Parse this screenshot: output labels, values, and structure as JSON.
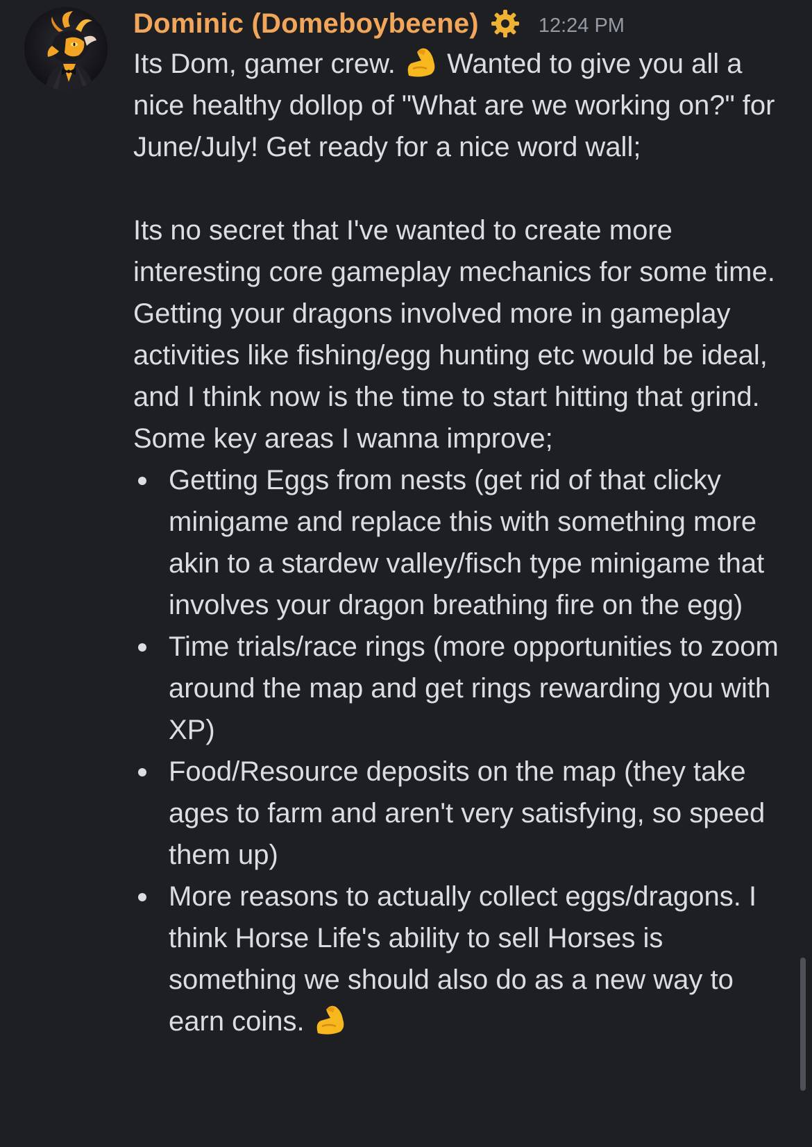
{
  "message": {
    "author": {
      "display_name": "Dominic (Domeboybeene)",
      "avatar_icon": "dragon-avatar-icon",
      "role_icon": "gear-icon",
      "name_color": "#f2a65a"
    },
    "timestamp": "12:24 PM",
    "paragraph_1_before_emoji": "Its Dom, gamer crew. ",
    "emoji_1": "flexed-biceps-icon",
    "paragraph_1_after_emoji": " Wanted to give you all a nice healthy dollop of \"What are we working on?\" for June/July! Get ready for a nice word wall;",
    "paragraph_2": "Its no secret that I've wanted to create more interesting core gameplay mechanics for some time. Getting your dragons involved more in gameplay activities like fishing/egg hunting etc would be ideal, and I think now is the time to start hitting that grind. Some key areas I wanna improve;",
    "bullets": [
      {
        "text": "Getting Eggs from nests (get rid of that clicky minigame and replace this with something more akin to a stardew valley/fisch type minigame that involves your dragon breathing fire on the egg)"
      },
      {
        "text": "Time trials/race rings (more opportunities to zoom around the map and get rings rewarding you with XP)"
      },
      {
        "text": "Food/Resource deposits on the map (they take ages to farm and aren't very satisfying, so speed them up)"
      },
      {
        "text": "More reasons to actually collect eggs/dragons. I think Horse Life's ability to sell Horses is something we should also do as a new way to earn coins. ",
        "emoji": "flexed-biceps-icon"
      }
    ]
  },
  "colors": {
    "background": "#1e1f23",
    "text": "#dbdee1",
    "timestamp": "#949ba4",
    "role_icon": "#f0b232",
    "emoji": "#f7b81f"
  }
}
